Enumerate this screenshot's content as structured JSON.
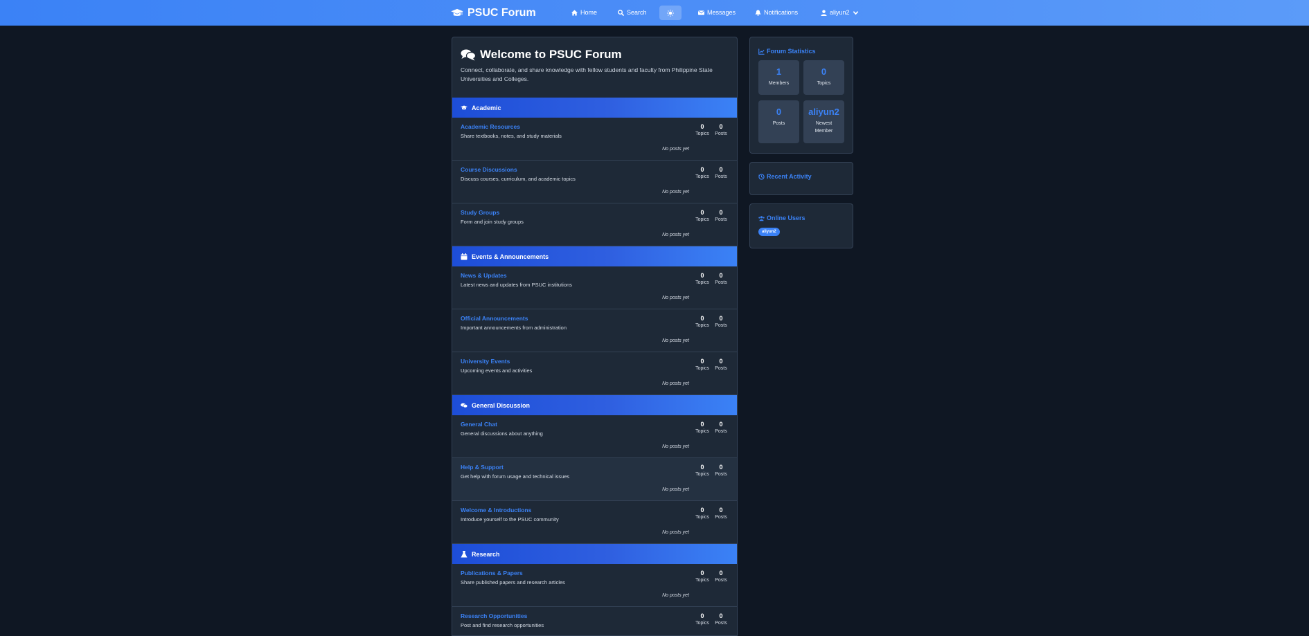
{
  "nav": {
    "brand": "PSUC Forum",
    "home": "Home",
    "search": "Search",
    "messages": "Messages",
    "notifications": "Notifications",
    "user": "aliyun2"
  },
  "welcome": {
    "title": "Welcome to PSUC Forum",
    "subtitle": "Connect, collaborate, and share knowledge with fellow students and faculty from Philippine State Universities and Colleges."
  },
  "labels": {
    "topics": "Topics",
    "posts": "Posts",
    "no_posts": "No posts yet"
  },
  "categories": [
    {
      "name": "Academic",
      "icon": "graduation-cap-icon",
      "forums": [
        {
          "title": "Academic Resources",
          "desc": "Share textbooks, notes, and study materials",
          "topics": "0",
          "posts": "0"
        },
        {
          "title": "Course Discussions",
          "desc": "Discuss courses, curriculum, and academic topics",
          "topics": "0",
          "posts": "0"
        },
        {
          "title": "Study Groups",
          "desc": "Form and join study groups",
          "topics": "0",
          "posts": "0"
        }
      ]
    },
    {
      "name": "Events & Announcements",
      "icon": "calendar-icon",
      "forums": [
        {
          "title": "News & Updates",
          "desc": "Latest news and updates from PSUC institutions",
          "topics": "0",
          "posts": "0"
        },
        {
          "title": "Official Announcements",
          "desc": "Important announcements from administration",
          "topics": "0",
          "posts": "0"
        },
        {
          "title": "University Events",
          "desc": "Upcoming events and activities",
          "topics": "0",
          "posts": "0"
        }
      ]
    },
    {
      "name": "General Discussion",
      "icon": "comments-icon",
      "forums": [
        {
          "title": "General Chat",
          "desc": "General discussions about anything",
          "topics": "0",
          "posts": "0"
        },
        {
          "title": "Help & Support",
          "desc": "Get help with forum usage and technical issues",
          "topics": "0",
          "posts": "0"
        },
        {
          "title": "Welcome & Introductions",
          "desc": "Introduce yourself to the PSUC community",
          "topics": "0",
          "posts": "0"
        }
      ]
    },
    {
      "name": "Research",
      "icon": "flask-icon",
      "forums": [
        {
          "title": "Publications & Papers",
          "desc": "Share published papers and research articles",
          "topics": "0",
          "posts": "0"
        },
        {
          "title": "Research Opportunities",
          "desc": "Post and find research opportunities",
          "topics": "0",
          "posts": "0"
        }
      ]
    }
  ],
  "sidebar": {
    "stats_title": "Forum Statistics",
    "stats": {
      "members_value": "1",
      "members_label": "Members",
      "topics_value": "0",
      "topics_label": "Topics",
      "posts_value": "0",
      "posts_label": "Posts",
      "newest_value": "aliyun2",
      "newest_label": "Newest Member"
    },
    "activity_title": "Recent Activity",
    "online_title": "Online Users",
    "online_users": [
      "aliyun2"
    ]
  },
  "colors": {
    "navbar": "#3b82f6",
    "background": "#0f1723",
    "card": "#1e2937",
    "accent": "#3b82f6"
  }
}
